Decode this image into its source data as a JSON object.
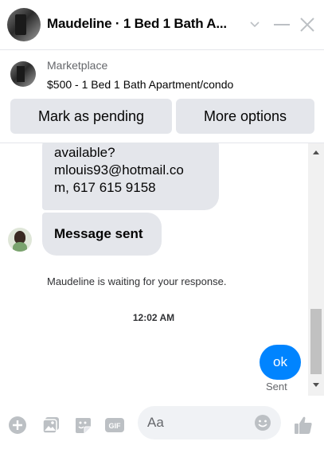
{
  "header": {
    "title": "Maudeline · 1 Bed 1 Bath A...",
    "icons": [
      "chevron-down-icon",
      "minimize-icon",
      "close-icon"
    ]
  },
  "marketplace": {
    "label": "Marketplace",
    "item": "$500 - 1 Bed 1 Bath Apartment/condo",
    "mark_pending_label": "Mark as pending",
    "more_options_label": "More options"
  },
  "messages": {
    "received": [
      {
        "lines": [
          "available?",
          "mlouis93@hotmail.co",
          "m, 617 615 9158"
        ]
      },
      {
        "text": "Message sent"
      }
    ],
    "waiting_notice": "Maudeline is waiting for your response.",
    "timestamp": "12:02 AM",
    "sent": {
      "text": "ok",
      "status": "Sent"
    }
  },
  "composer": {
    "placeholder": "Aa",
    "icons": [
      "plus-icon",
      "image-icon",
      "sticker-icon",
      "gif-icon",
      "emoji-icon",
      "thumbs-up-icon"
    ]
  },
  "colors": {
    "accent": "#0084ff",
    "bubble_received": "#e4e6eb",
    "button_bg": "#e4e6eb",
    "icon_gray": "#bcc0c4"
  }
}
